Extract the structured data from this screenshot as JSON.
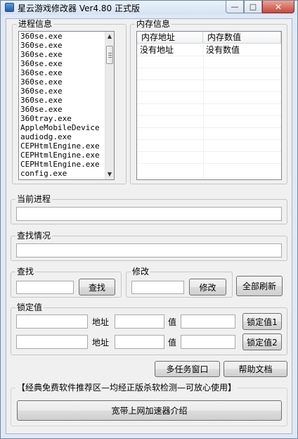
{
  "window": {
    "title": "星云游戏修改器 Ver4.80 正式版",
    "controls": {
      "minimize": "—",
      "maximize": "□",
      "close": "✕"
    }
  },
  "process_group": {
    "label": "进程信息",
    "items": [
      "360se.exe",
      "360se.exe",
      "360se.exe",
      "360se.exe",
      "360se.exe",
      "360se.exe",
      "360se.exe",
      "360se.exe",
      "360se.exe",
      "360tray.exe",
      "AppleMobileDevice",
      "audiodg.exe",
      "CEPHtmlEngine.exe",
      "CEPHtmlEngine.exe",
      "CEPHtmlEngine.exe",
      "config.exe"
    ]
  },
  "memory_group": {
    "label": "内存信息",
    "columns": [
      "内存地址",
      "内存数值"
    ],
    "rows": [
      [
        "没有地址",
        "没有数值"
      ]
    ]
  },
  "current_process": {
    "label": "当前进程",
    "value": ""
  },
  "search_status": {
    "label": "查找情况",
    "value": ""
  },
  "search": {
    "label": "查找",
    "value": "",
    "button": "查找"
  },
  "modify": {
    "label": "修改",
    "value": "",
    "button": "修改"
  },
  "refresh_all": {
    "button": "全部刷新"
  },
  "lock": {
    "label": "锁定值",
    "rows": [
      {
        "addr_label": "地址",
        "val_label": "值",
        "button": "锁定值1"
      },
      {
        "addr_label": "地址",
        "val_label": "值",
        "button": "锁定值2"
      }
    ]
  },
  "bottom_buttons": {
    "multitask": "多任务窗口",
    "help": "帮助文档"
  },
  "recommend": {
    "label": "【经典免费软件推荐区—均经正版杀软检测—可放心使用】",
    "button": "宽带上网加速器介绍"
  },
  "colors": {
    "frame": "#dfe9f5",
    "client": "#f0f0f0",
    "close": "#c9483a"
  }
}
